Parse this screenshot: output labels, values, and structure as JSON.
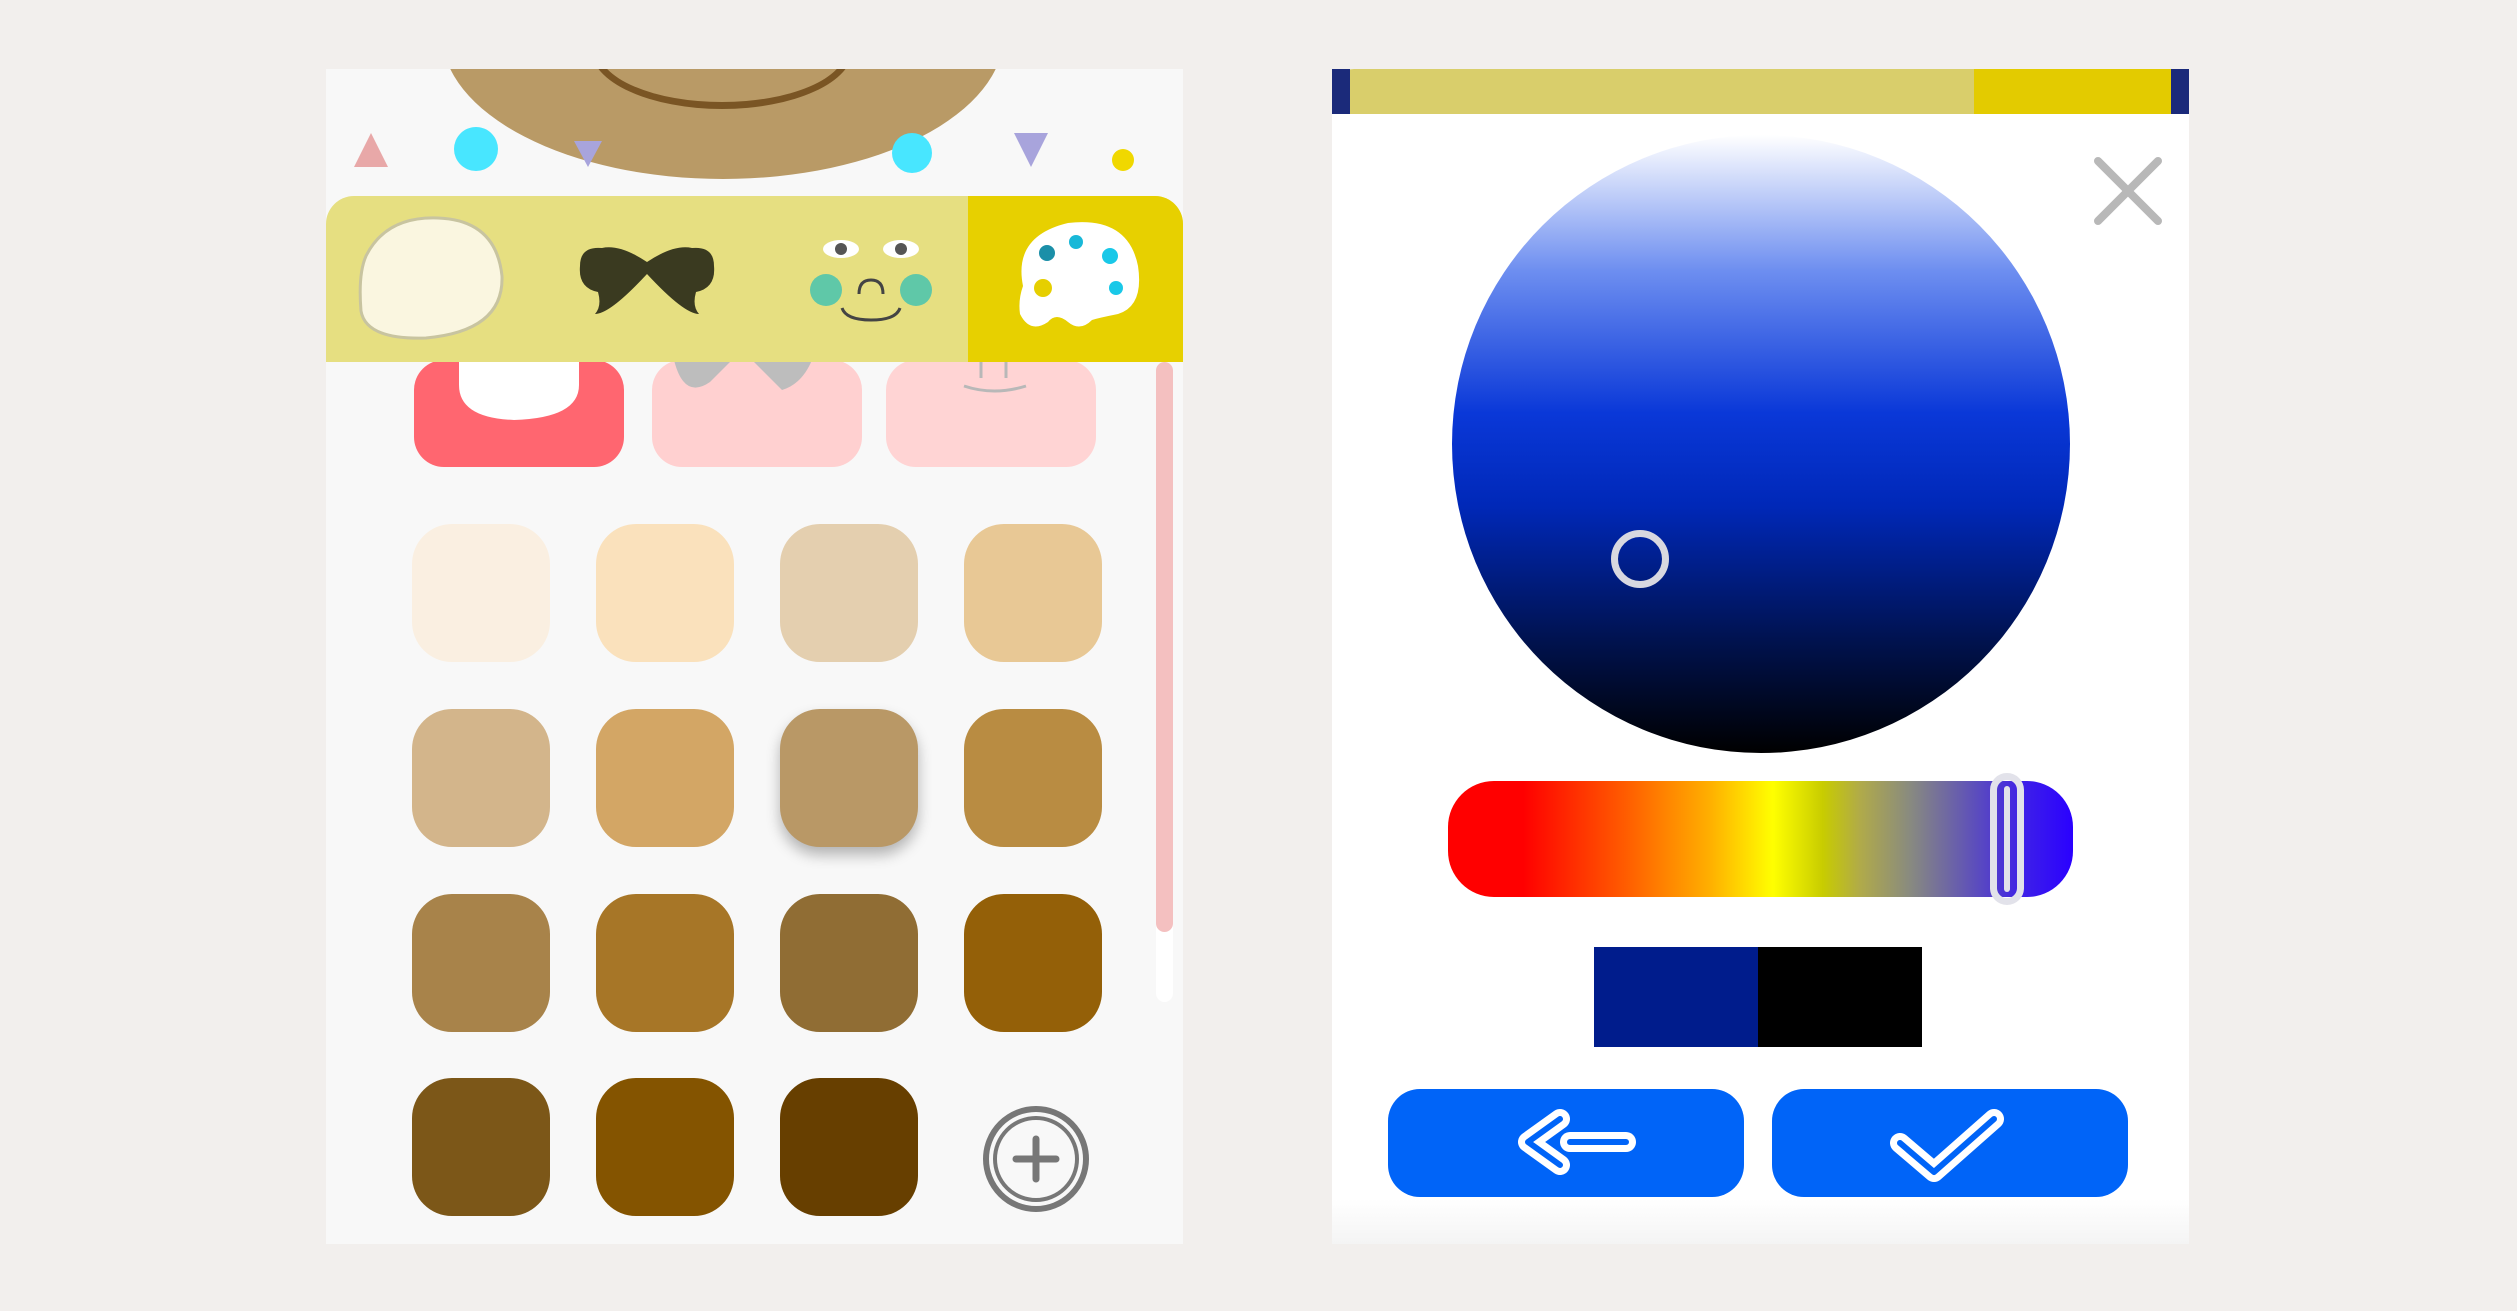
{
  "colors": {
    "background": "#f2efed",
    "category_bar": "#e6df81",
    "category_active": "#e7d000",
    "accent_blue": "#0064f8",
    "scrollbar": "#f4c0c0"
  },
  "left_panel": {
    "category_tabs": [
      {
        "name": "face-shape",
        "icon": "face-shape-icon",
        "active": false
      },
      {
        "name": "hair",
        "icon": "hair-icon",
        "active": false
      },
      {
        "name": "face-features",
        "icon": "face-features-icon",
        "active": false
      },
      {
        "name": "color-palette",
        "icon": "palette-icon",
        "active": true
      }
    ],
    "part_tiles": [
      {
        "name": "face-part",
        "selected": true
      },
      {
        "name": "hair-part",
        "selected": false
      },
      {
        "name": "features-part",
        "selected": false
      }
    ],
    "swatches": [
      "#faefe1",
      "#fae1bc",
      "#e4cfaf",
      "#e8c895",
      "#d3b58b",
      "#d3a665",
      "#b99866",
      "#b98c42",
      "#a8834a",
      "#a77627",
      "#906d34",
      "#946008",
      "#7c5718",
      "#845400",
      "#673f00"
    ],
    "selected_swatch_index": 6,
    "add_color_icon": "plus-circle-icon"
  },
  "right_panel": {
    "close_icon": "close-icon",
    "color_picker": {
      "hue": 235,
      "preview_new": "#001c8c",
      "preview_old": "#000000"
    },
    "back_icon": "back-arrow-icon",
    "confirm_icon": "checkmark-icon"
  }
}
